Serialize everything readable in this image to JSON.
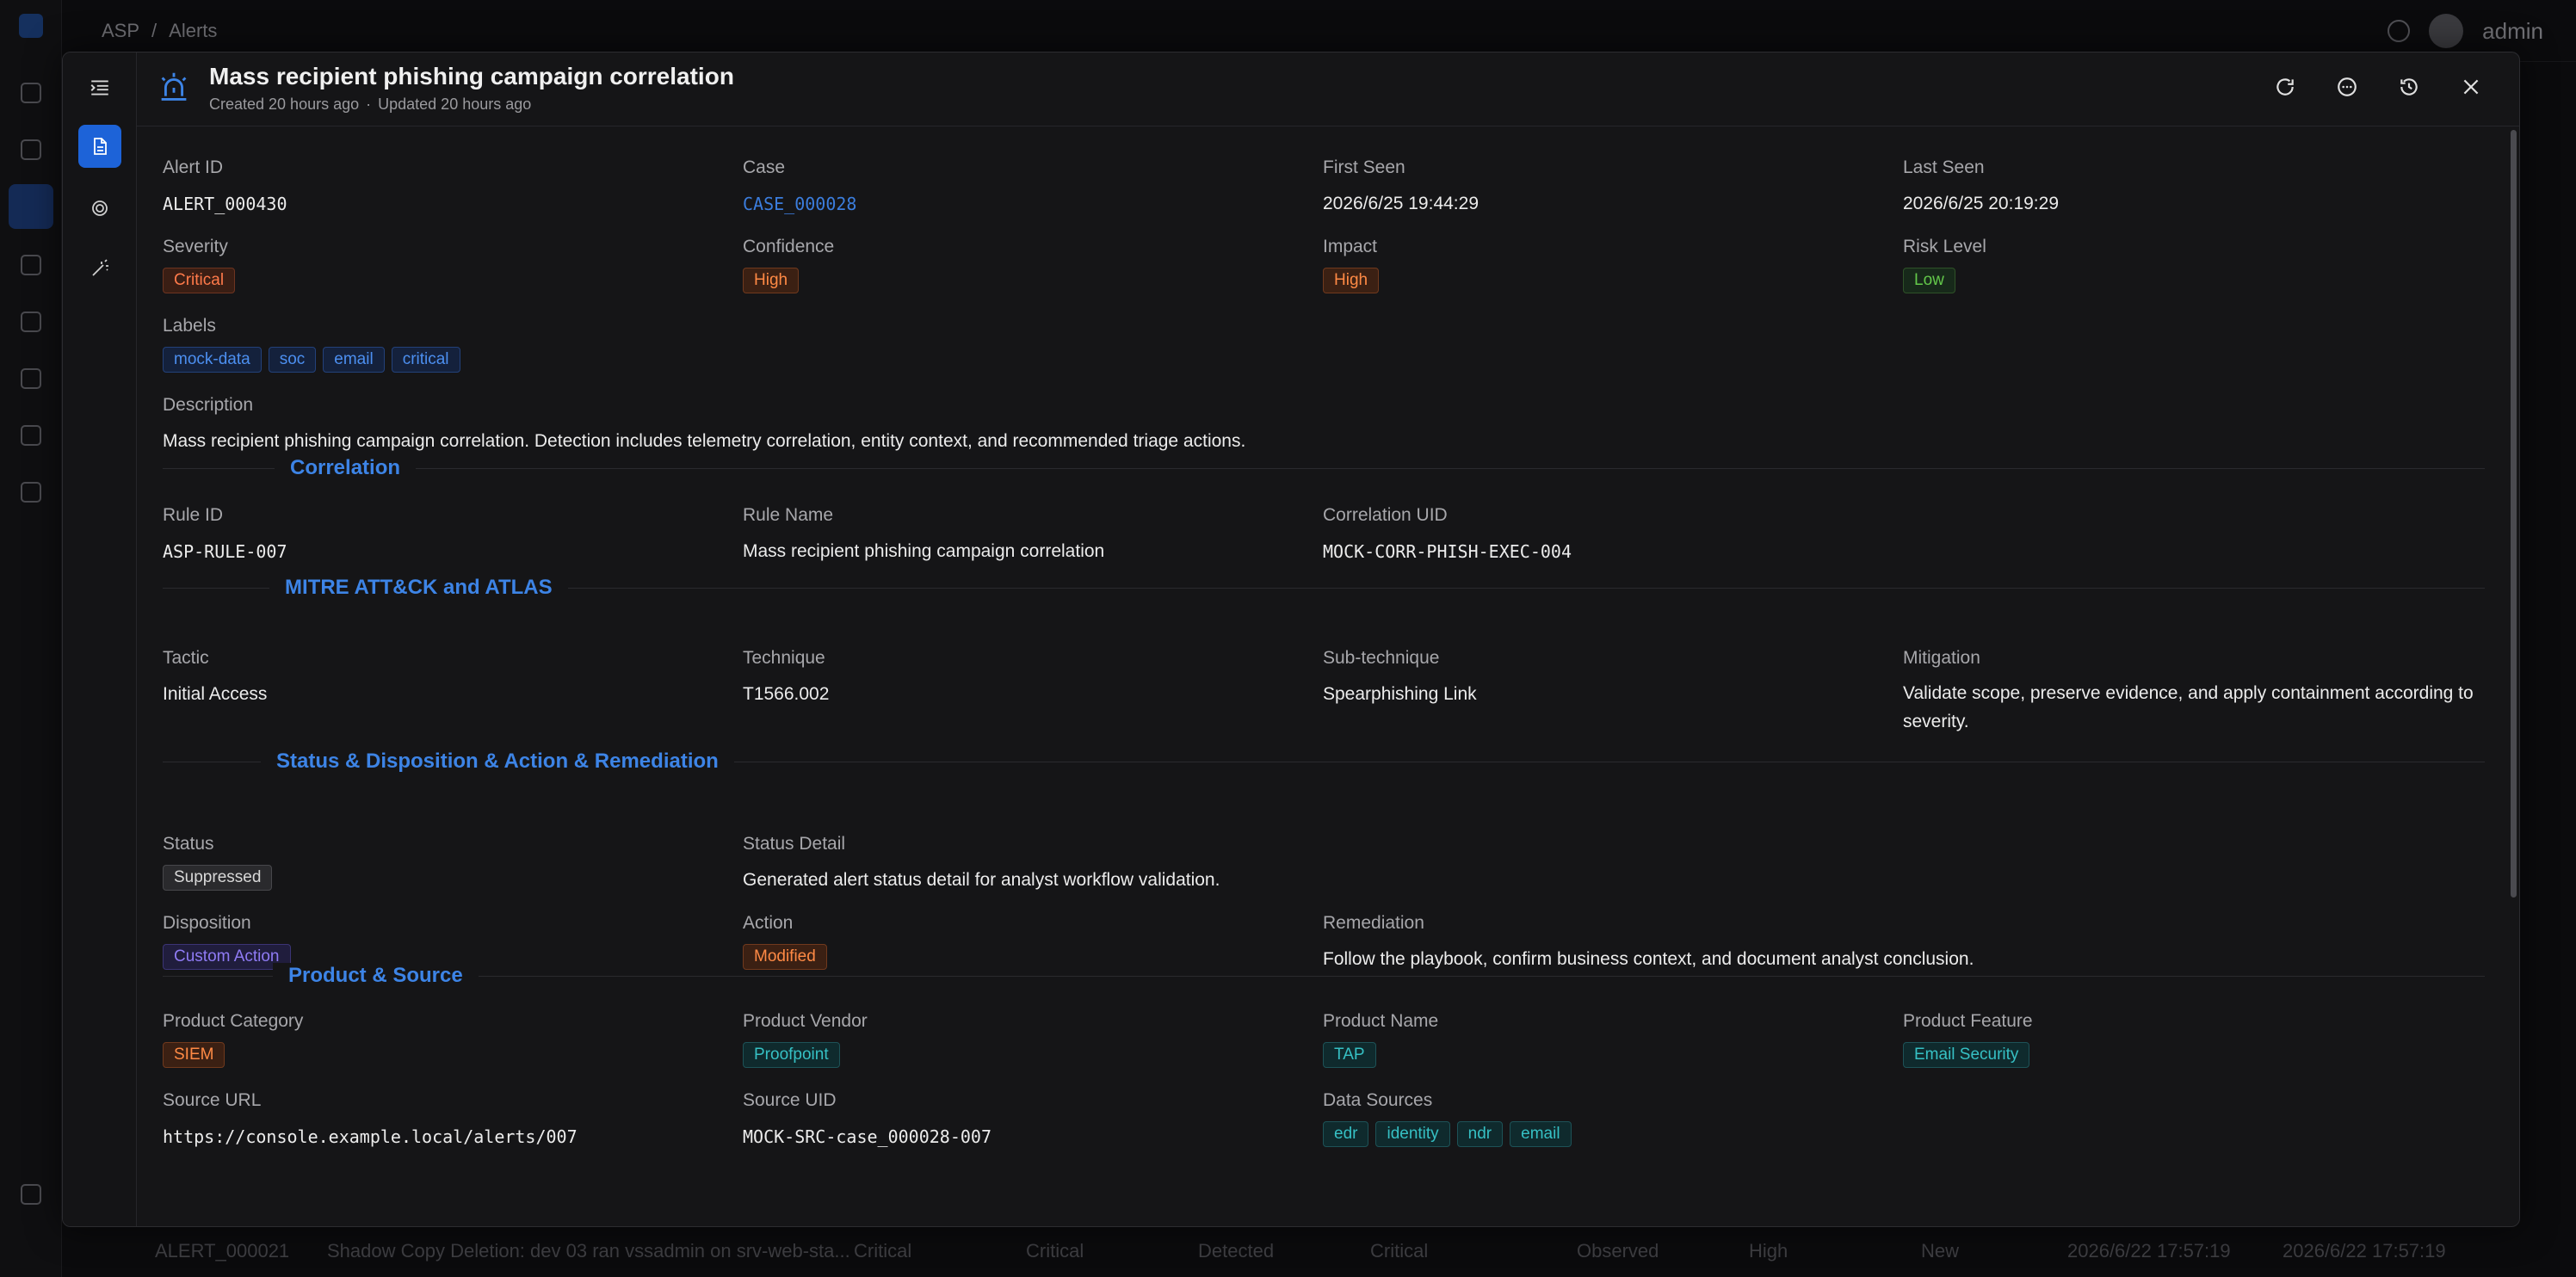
{
  "app": {
    "breadcrumb": [
      "ASP",
      "Alerts"
    ],
    "user": "admin",
    "background_row": [
      "ALERT_000021",
      "Shadow Copy Deletion: dev 03 ran vssadmin on srv-web-sta...",
      "Critical",
      "Critical",
      "Detected",
      "Critical",
      "Observed",
      "High",
      "New",
      "2026/6/22 17:57:19",
      "2026/6/22 17:57:19"
    ]
  },
  "modal": {
    "title": "Mass recipient phishing campaign correlation",
    "created": "Created 20 hours ago",
    "separator": "·",
    "updated": "Updated 20 hours ago"
  },
  "overview": {
    "alert_id": {
      "label": "Alert ID",
      "value": "ALERT_000430"
    },
    "case": {
      "label": "Case",
      "value": "CASE_000028"
    },
    "first_seen": {
      "label": "First Seen",
      "value": "2026/6/25 19:44:29"
    },
    "last_seen": {
      "label": "Last Seen",
      "value": "2026/6/25 20:19:29"
    },
    "severity": {
      "label": "Severity",
      "value": "Critical"
    },
    "confidence": {
      "label": "Confidence",
      "value": "High"
    },
    "impact": {
      "label": "Impact",
      "value": "High"
    },
    "risk_level": {
      "label": "Risk Level",
      "value": "Low"
    },
    "labels": {
      "label": "Labels",
      "values": [
        "mock-data",
        "soc",
        "email",
        "critical"
      ]
    },
    "description": {
      "label": "Description",
      "value": "Mass recipient phishing campaign correlation. Detection includes telemetry correlation, entity context, and recommended triage actions."
    }
  },
  "correlation": {
    "title": "Correlation",
    "rule_id": {
      "label": "Rule ID",
      "value": "ASP-RULE-007"
    },
    "rule_name": {
      "label": "Rule Name",
      "value": "Mass recipient phishing campaign correlation"
    },
    "correlation_uid": {
      "label": "Correlation UID",
      "value": "MOCK-CORR-PHISH-EXEC-004"
    }
  },
  "mitre": {
    "title": "MITRE ATT&CK and ATLAS",
    "tactic": {
      "label": "Tactic",
      "value": "Initial Access"
    },
    "technique": {
      "label": "Technique",
      "value": "T1566.002"
    },
    "sub_technique": {
      "label": "Sub-technique",
      "value": "Spearphishing Link"
    },
    "mitigation": {
      "label": "Mitigation",
      "value": "Validate scope, preserve evidence, and apply containment according to severity."
    }
  },
  "status": {
    "title": "Status & Disposition & Action & Remediation",
    "status": {
      "label": "Status",
      "value": "Suppressed"
    },
    "status_detail": {
      "label": "Status Detail",
      "value": "Generated alert status detail for analyst workflow validation."
    },
    "disposition": {
      "label": "Disposition",
      "value": "Custom Action"
    },
    "action": {
      "label": "Action",
      "value": "Modified"
    },
    "remediation": {
      "label": "Remediation",
      "value": "Follow the playbook, confirm business context, and document analyst conclusion."
    }
  },
  "product": {
    "title": "Product & Source",
    "category": {
      "label": "Product Category",
      "value": "SIEM"
    },
    "vendor": {
      "label": "Product Vendor",
      "value": "Proofpoint"
    },
    "name": {
      "label": "Product Name",
      "value": "TAP"
    },
    "feature": {
      "label": "Product Feature",
      "value": "Email Security"
    },
    "source_url": {
      "label": "Source URL",
      "value": "https://console.example.local/alerts/007"
    },
    "source_uid": {
      "label": "Source UID",
      "value": "MOCK-SRC-case_000028-007"
    },
    "data_sources": {
      "label": "Data Sources",
      "values": [
        "edr",
        "identity",
        "ndr",
        "email"
      ]
    }
  },
  "colors": {
    "accent": "#1d63d8",
    "section_title": "#3d84e6",
    "critical": "#ff7a4a",
    "low": "#63c84a",
    "product_tag": "#36c0c4"
  }
}
